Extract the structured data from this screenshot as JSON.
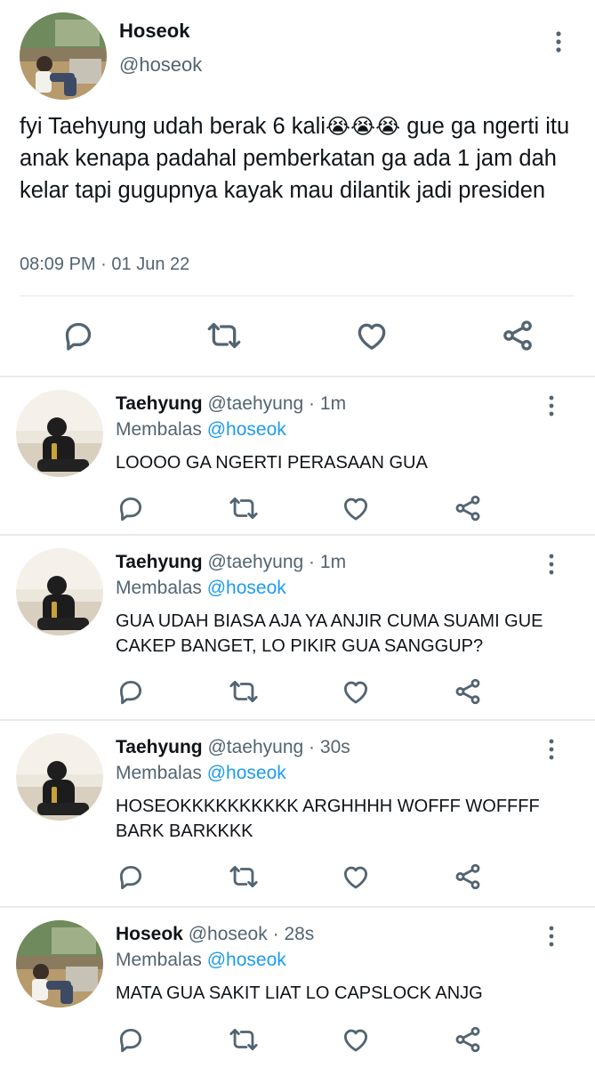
{
  "main_tweet": {
    "name": "Hoseok",
    "handle": "@hoseok",
    "text_before": "fyi Taehyung udah berak 6 kali",
    "emoji": "😭😭😭",
    "text_after": " gue ga ngerti itu anak kenapa padahal pemberkatan ga ada 1 jam dah kelar tapi gugupnya kayak mau dilantik jadi presiden",
    "time": "08:09 PM",
    "separator": "·",
    "date": "01 Jun 22",
    "actions": [
      "reply-icon",
      "retweet-icon",
      "like-icon",
      "share-icon"
    ]
  },
  "replies": [
    {
      "name": "Taehyung",
      "handle": "@taehyung",
      "separator": "·",
      "time": "1m",
      "replying_label": "Membalas",
      "replying_to": "@hoseok",
      "text": "LOOOO GA NGERTI PERASAAN GUA"
    },
    {
      "name": "Taehyung",
      "handle": "@taehyung",
      "separator": "·",
      "time": "1m",
      "replying_label": "Membalas",
      "replying_to": "@hoseok",
      "text": "GUA UDAH BIASA AJA YA ANJIR CUMA SUAMI GUE CAKEP BANGET, LO PIKIR GUA SANGGUP?"
    },
    {
      "name": "Taehyung",
      "handle": "@taehyung",
      "separator": "·",
      "time": "30s",
      "replying_label": "Membalas",
      "replying_to": "@hoseok",
      "text": "HOSEOKKKKKKKKKK ARGHHHH WOFFF WOFFFF BARK BARKKKK"
    },
    {
      "name": "Hoseok",
      "handle": "@hoseok",
      "separator": "·",
      "time": "28s",
      "replying_label": "Membalas",
      "replying_to": "@hoseok",
      "text": "MATA GUA SAKIT LIAT LO CAPSLOCK ANJG"
    }
  ],
  "colors": {
    "text": "#0f1419",
    "muted": "#536471",
    "mention": "#1d9bf0",
    "divider": "#e7eaed"
  }
}
